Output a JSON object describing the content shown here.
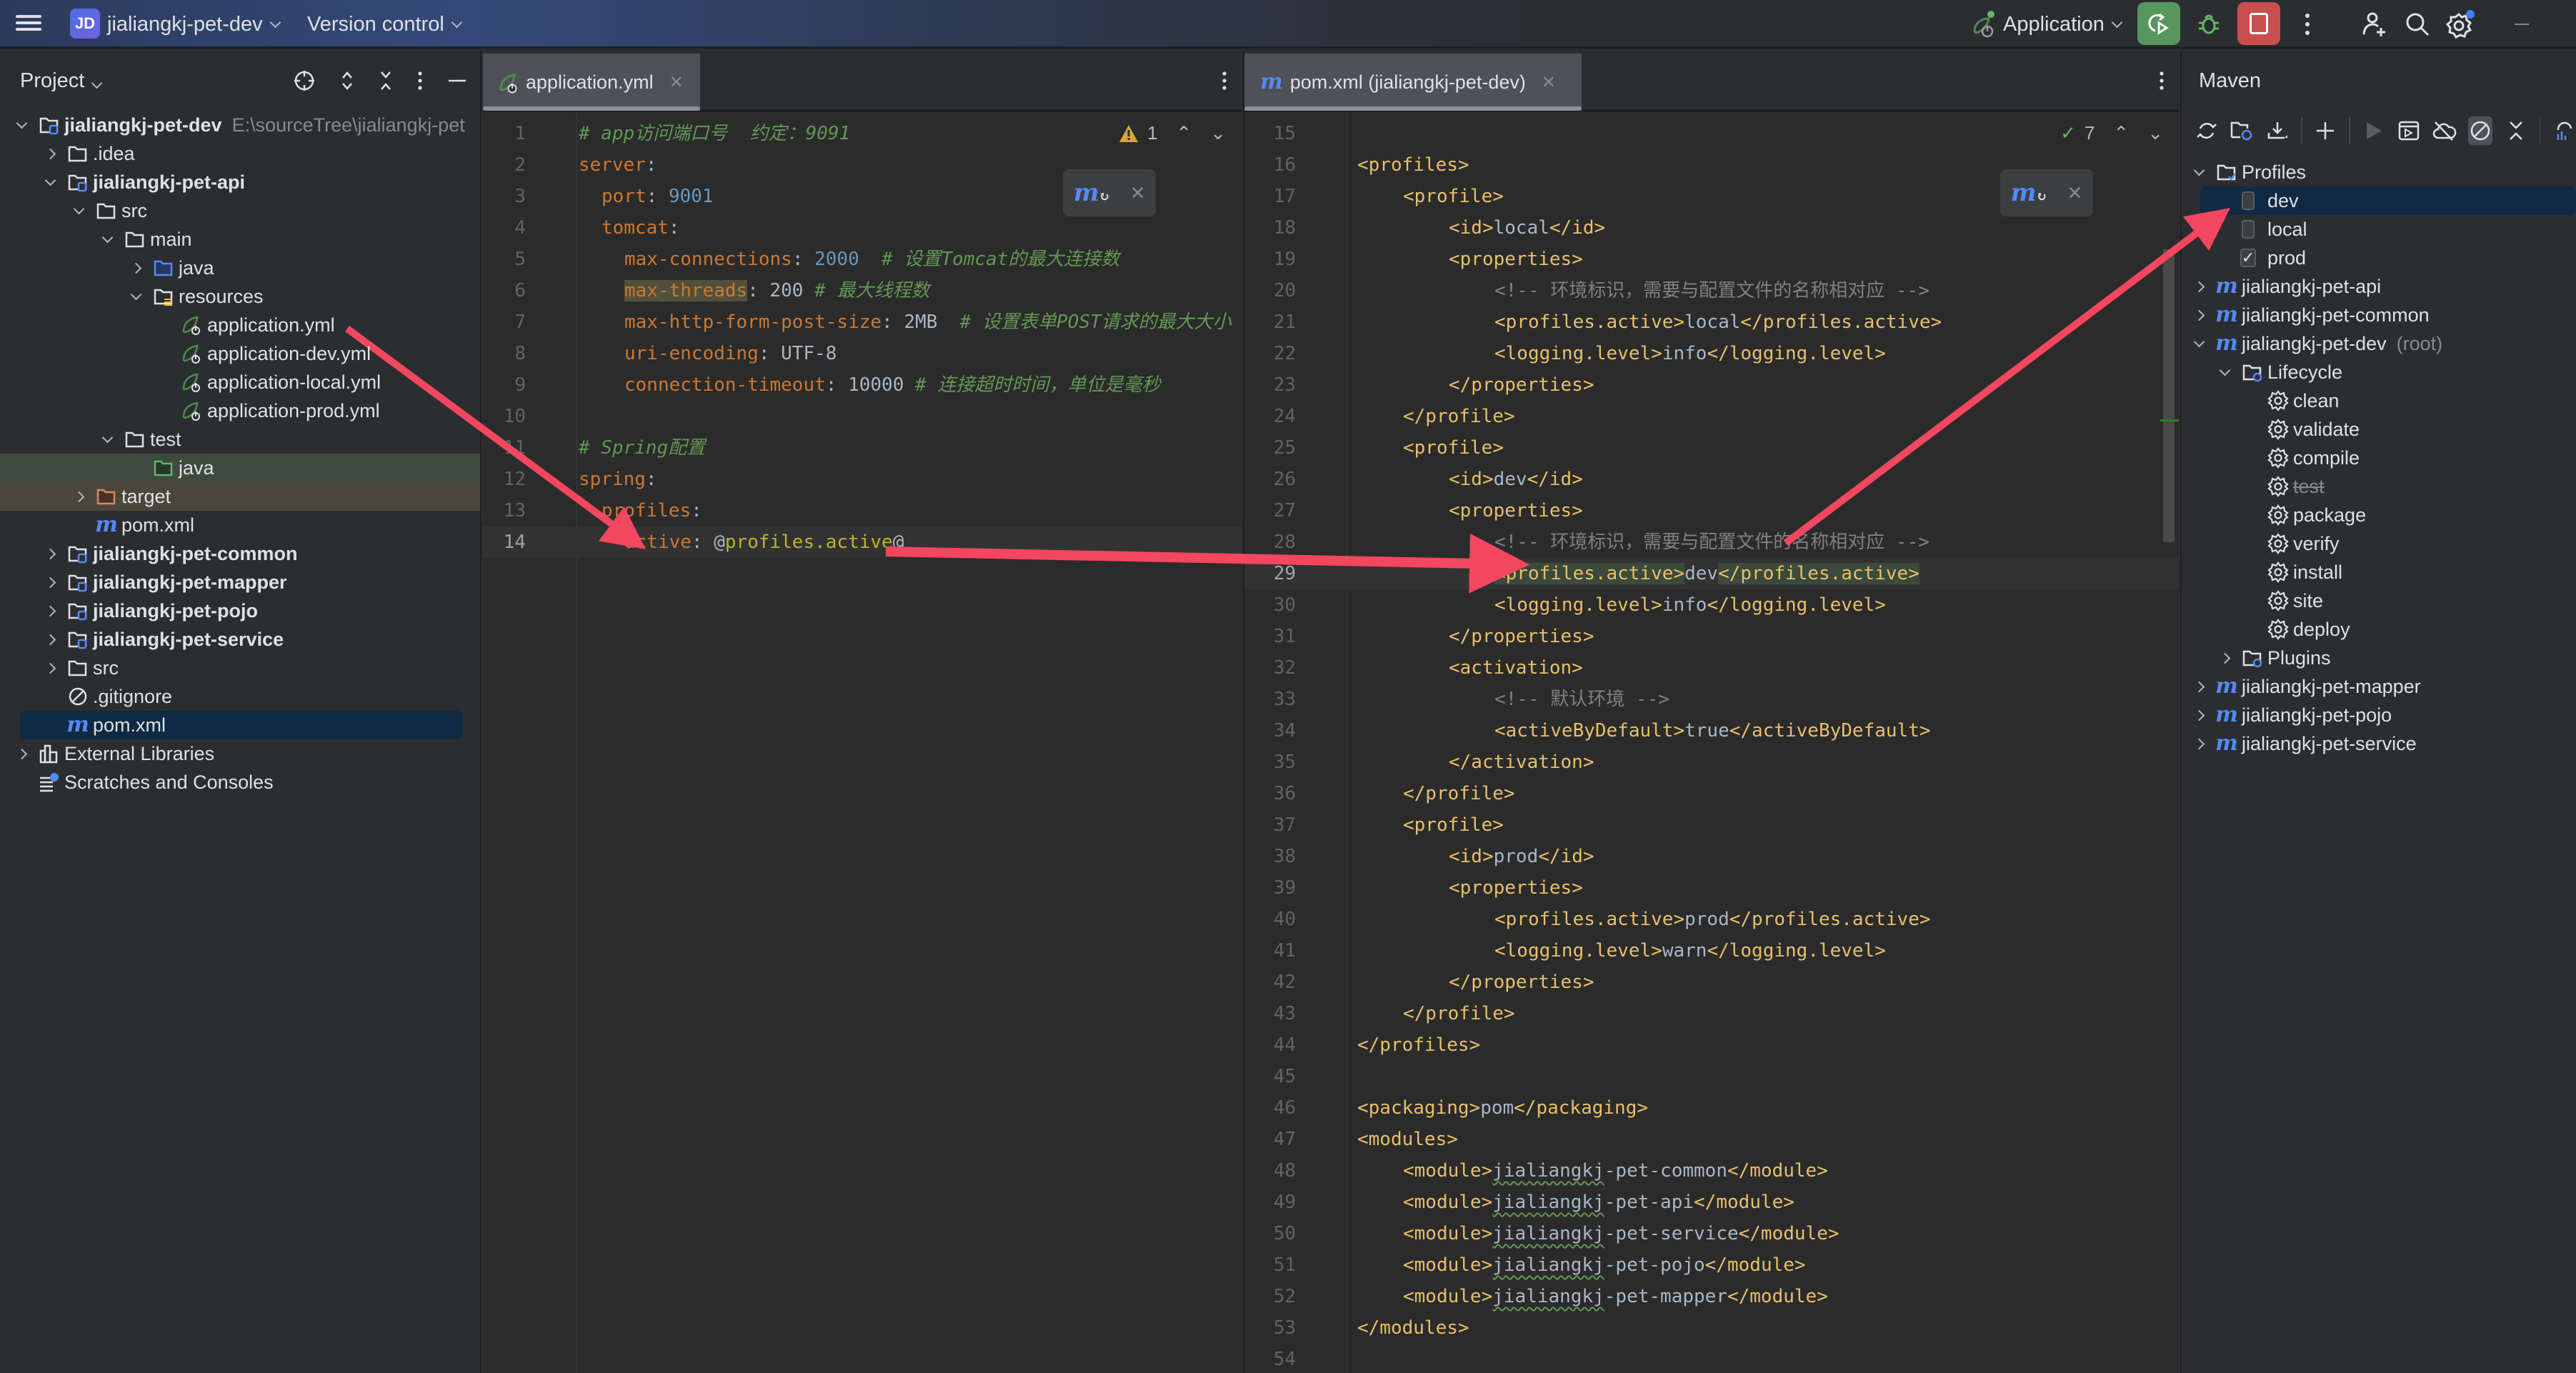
{
  "titlebar": {
    "project_badge": "JD",
    "project_name": "jialiangkj-pet-dev",
    "version_control": "Version control",
    "run_config": "Application",
    "icons": [
      "main-menu-icon",
      "rerun-icon",
      "debug-icon",
      "stop-icon",
      "more-icon",
      "add-user-icon",
      "search-icon",
      "settings-icon",
      "minimize-icon"
    ]
  },
  "project_panel": {
    "title": "Project",
    "icons": [
      "locate-icon",
      "expand-all-icon",
      "collapse-all-icon",
      "more-icon",
      "hide-icon"
    ],
    "tree": [
      {
        "depth": 0,
        "expand": "down",
        "icon": "module",
        "label": "jialiangkj-pet-dev",
        "bold": true,
        "path": "E:\\sourceTree\\jialiangkj-pet"
      },
      {
        "depth": 1,
        "expand": "right",
        "icon": "folder",
        "label": ".idea"
      },
      {
        "depth": 1,
        "expand": "down",
        "icon": "module",
        "label": "jialiangkj-pet-api",
        "bold": true
      },
      {
        "depth": 2,
        "expand": "down",
        "icon": "folder",
        "label": "src"
      },
      {
        "depth": 3,
        "expand": "down",
        "icon": "folder",
        "label": "main"
      },
      {
        "depth": 4,
        "expand": "right",
        "icon": "folder-source",
        "label": "java"
      },
      {
        "depth": 4,
        "expand": "down",
        "icon": "folder-resources",
        "label": "resources"
      },
      {
        "depth": 5,
        "expand": "none",
        "icon": "spring",
        "label": "application.yml"
      },
      {
        "depth": 5,
        "expand": "none",
        "icon": "spring",
        "label": "application-dev.yml"
      },
      {
        "depth": 5,
        "expand": "none",
        "icon": "spring",
        "label": "application-local.yml"
      },
      {
        "depth": 5,
        "expand": "none",
        "icon": "spring",
        "label": "application-prod.yml"
      },
      {
        "depth": 3,
        "expand": "down",
        "icon": "folder",
        "label": "test"
      },
      {
        "depth": 4,
        "expand": "none",
        "icon": "folder-test",
        "label": "java",
        "row": "test"
      },
      {
        "depth": 2,
        "expand": "right",
        "icon": "folder-excluded",
        "label": "target",
        "row": "target"
      },
      {
        "depth": 2,
        "expand": "none",
        "icon": "maven",
        "label": "pom.xml"
      },
      {
        "depth": 1,
        "expand": "right",
        "icon": "module",
        "label": "jialiangkj-pet-common",
        "bold": true
      },
      {
        "depth": 1,
        "expand": "right",
        "icon": "module",
        "label": "jialiangkj-pet-mapper",
        "bold": true
      },
      {
        "depth": 1,
        "expand": "right",
        "icon": "module",
        "label": "jialiangkj-pet-pojo",
        "bold": true
      },
      {
        "depth": 1,
        "expand": "right",
        "icon": "module",
        "label": "jialiangkj-pet-service",
        "bold": true
      },
      {
        "depth": 1,
        "expand": "right",
        "icon": "folder",
        "label": "src"
      },
      {
        "depth": 1,
        "expand": "none",
        "icon": "ignore",
        "label": ".gitignore"
      },
      {
        "depth": 1,
        "expand": "none",
        "icon": "maven",
        "label": "pom.xml",
        "row": "selected"
      },
      {
        "depth": 0,
        "expand": "right",
        "icon": "library",
        "label": "External Libraries"
      },
      {
        "depth": 0,
        "expand": "none",
        "icon": "scratches",
        "label": "Scratches and Consoles"
      }
    ]
  },
  "editor_left": {
    "tab_label": "application.yml",
    "inspection": {
      "warnings": "1"
    },
    "lines": [
      {
        "n": "1",
        "indent": 0,
        "parts": [
          [
            "c-cmt",
            "# app访问端口号  约定：9091"
          ]
        ]
      },
      {
        "n": "2",
        "indent": 0,
        "parts": [
          [
            "c-key",
            "server"
          ],
          [
            "c-punc",
            ":"
          ]
        ]
      },
      {
        "n": "3",
        "indent": 1,
        "parts": [
          [
            "c-key",
            "port"
          ],
          [
            "c-punc",
            ": "
          ],
          [
            "c-num",
            "9001"
          ]
        ]
      },
      {
        "n": "4",
        "indent": 1,
        "parts": [
          [
            "c-key",
            "tomcat"
          ],
          [
            "c-punc",
            ":"
          ]
        ]
      },
      {
        "n": "5",
        "indent": 2,
        "parts": [
          [
            "c-key",
            "max-connections"
          ],
          [
            "c-punc",
            ": "
          ],
          [
            "c-num",
            "2000"
          ],
          [
            "c-cmt",
            "  # 设置Tomcat的最大连接数"
          ]
        ]
      },
      {
        "n": "6",
        "indent": 2,
        "parts": [
          [
            "c-key hl-word",
            "max-threads"
          ],
          [
            "c-punc",
            ": "
          ],
          [
            "c-val",
            "200"
          ],
          [
            "c-cmt",
            " # 最大线程数"
          ]
        ]
      },
      {
        "n": "7",
        "indent": 2,
        "parts": [
          [
            "c-key",
            "max-http-form-post-size"
          ],
          [
            "c-punc",
            ": "
          ],
          [
            "c-val",
            "2MB"
          ],
          [
            "c-cmt",
            "  # 设置表单POST请求的最大大小"
          ]
        ]
      },
      {
        "n": "8",
        "indent": 2,
        "parts": [
          [
            "c-key",
            "uri-encoding"
          ],
          [
            "c-punc",
            ": "
          ],
          [
            "c-val",
            "UTF-8"
          ]
        ]
      },
      {
        "n": "9",
        "indent": 2,
        "parts": [
          [
            "c-key",
            "connection-timeout"
          ],
          [
            "c-punc",
            ": "
          ],
          [
            "c-val",
            "10000"
          ],
          [
            "c-cmt",
            " # 连接超时时间，单位是毫秒"
          ]
        ]
      },
      {
        "n": "10",
        "indent": 0,
        "parts": []
      },
      {
        "n": "11",
        "indent": 0,
        "parts": [
          [
            "c-cmt",
            "# Spring配置"
          ]
        ]
      },
      {
        "n": "12",
        "indent": 0,
        "parts": [
          [
            "c-key",
            "spring"
          ],
          [
            "c-punc",
            ":"
          ]
        ]
      },
      {
        "n": "13",
        "indent": 1,
        "parts": [
          [
            "c-key",
            "profiles"
          ],
          [
            "c-punc",
            ":"
          ]
        ]
      },
      {
        "n": "14",
        "indent": 2,
        "current": true,
        "parts": [
          [
            "c-key",
            "active"
          ],
          [
            "c-punc",
            ": "
          ],
          [
            "c-punc",
            "@"
          ],
          [
            "c-at",
            "profiles.active"
          ],
          [
            "c-punc",
            "@"
          ]
        ]
      }
    ]
  },
  "editor_right": {
    "tab_label": "pom.xml (jialiangkj-pet-dev)",
    "inspection": {
      "ok_count": "7"
    },
    "lines": [
      {
        "n": "15",
        "indent": 0,
        "parts": []
      },
      {
        "n": "16",
        "indent": 1,
        "parts": [
          [
            "c-tag",
            "<profiles>"
          ]
        ]
      },
      {
        "n": "17",
        "indent": 2,
        "parts": [
          [
            "c-tag",
            "<profile>"
          ]
        ]
      },
      {
        "n": "18",
        "indent": 3,
        "parts": [
          [
            "c-tag",
            "<id>"
          ],
          [
            "c-txt",
            "local"
          ],
          [
            "c-tag",
            "</id>"
          ]
        ]
      },
      {
        "n": "19",
        "indent": 3,
        "parts": [
          [
            "c-tag",
            "<properties>"
          ]
        ]
      },
      {
        "n": "20",
        "indent": 4,
        "parts": [
          [
            "c-xcmt",
            "<!-- 环境标识，需要与配置文件的名称相对应 -->"
          ]
        ]
      },
      {
        "n": "21",
        "indent": 4,
        "parts": [
          [
            "c-tag",
            "<profiles.active>"
          ],
          [
            "c-txt",
            "local"
          ],
          [
            "c-tag",
            "</profiles.active>"
          ]
        ]
      },
      {
        "n": "22",
        "indent": 4,
        "parts": [
          [
            "c-tag",
            "<logging.level>"
          ],
          [
            "c-txt",
            "info"
          ],
          [
            "c-tag",
            "</logging.level>"
          ]
        ]
      },
      {
        "n": "23",
        "indent": 3,
        "parts": [
          [
            "c-tag",
            "</properties>"
          ]
        ]
      },
      {
        "n": "24",
        "indent": 2,
        "parts": [
          [
            "c-tag",
            "</profile>"
          ]
        ]
      },
      {
        "n": "25",
        "indent": 2,
        "parts": [
          [
            "c-tag",
            "<profile>"
          ]
        ]
      },
      {
        "n": "26",
        "indent": 3,
        "parts": [
          [
            "c-tag",
            "<id>"
          ],
          [
            "c-txt",
            "dev"
          ],
          [
            "c-tag",
            "</id>"
          ]
        ]
      },
      {
        "n": "27",
        "indent": 3,
        "parts": [
          [
            "c-tag",
            "<properties>"
          ]
        ]
      },
      {
        "n": "28",
        "indent": 4,
        "parts": [
          [
            "c-xcmt",
            "<!-- 环境标识，需要与配置文件的名称相对应 -->"
          ]
        ]
      },
      {
        "n": "29",
        "indent": 4,
        "current": true,
        "parts": [
          [
            "c-tag hl-tag",
            "<profiles.active>"
          ],
          [
            "c-txt",
            "dev"
          ],
          [
            "c-tag hl-tag",
            "</profiles.active>"
          ]
        ]
      },
      {
        "n": "30",
        "indent": 4,
        "parts": [
          [
            "c-tag",
            "<logging.level>"
          ],
          [
            "c-txt",
            "info"
          ],
          [
            "c-tag",
            "</logging.level>"
          ]
        ]
      },
      {
        "n": "31",
        "indent": 3,
        "parts": [
          [
            "c-tag",
            "</properties>"
          ]
        ]
      },
      {
        "n": "32",
        "indent": 3,
        "parts": [
          [
            "c-tag",
            "<activation>"
          ]
        ]
      },
      {
        "n": "33",
        "indent": 4,
        "parts": [
          [
            "c-xcmt",
            "<!-- 默认环境 -->"
          ]
        ]
      },
      {
        "n": "34",
        "indent": 4,
        "parts": [
          [
            "c-tag",
            "<activeByDefault>"
          ],
          [
            "c-txt",
            "true"
          ],
          [
            "c-tag",
            "</activeByDefault>"
          ]
        ]
      },
      {
        "n": "35",
        "indent": 3,
        "parts": [
          [
            "c-tag",
            "</activation>"
          ]
        ]
      },
      {
        "n": "36",
        "indent": 2,
        "parts": [
          [
            "c-tag",
            "</profile>"
          ]
        ]
      },
      {
        "n": "37",
        "indent": 2,
        "parts": [
          [
            "c-tag",
            "<profile>"
          ]
        ]
      },
      {
        "n": "38",
        "indent": 3,
        "parts": [
          [
            "c-tag",
            "<id>"
          ],
          [
            "c-txt",
            "prod"
          ],
          [
            "c-tag",
            "</id>"
          ]
        ]
      },
      {
        "n": "39",
        "indent": 3,
        "parts": [
          [
            "c-tag",
            "<properties>"
          ]
        ]
      },
      {
        "n": "40",
        "indent": 4,
        "parts": [
          [
            "c-tag",
            "<profiles.active>"
          ],
          [
            "c-txt",
            "prod"
          ],
          [
            "c-tag",
            "</profiles.active>"
          ]
        ]
      },
      {
        "n": "41",
        "indent": 4,
        "parts": [
          [
            "c-tag",
            "<logging.level>"
          ],
          [
            "c-txt",
            "warn"
          ],
          [
            "c-tag",
            "</logging.level>"
          ]
        ]
      },
      {
        "n": "42",
        "indent": 3,
        "parts": [
          [
            "c-tag",
            "</properties>"
          ]
        ]
      },
      {
        "n": "43",
        "indent": 2,
        "parts": [
          [
            "c-tag",
            "</profile>"
          ]
        ]
      },
      {
        "n": "44",
        "indent": 1,
        "parts": [
          [
            "c-tag",
            "</profiles>"
          ]
        ]
      },
      {
        "n": "45",
        "indent": 0,
        "parts": []
      },
      {
        "n": "46",
        "indent": 1,
        "parts": [
          [
            "c-tag",
            "<packaging>"
          ],
          [
            "c-txt",
            "pom"
          ],
          [
            "c-tag",
            "</packaging>"
          ]
        ]
      },
      {
        "n": "47",
        "indent": 1,
        "parts": [
          [
            "c-tag",
            "<modules>"
          ]
        ]
      },
      {
        "n": "48",
        "indent": 2,
        "parts": [
          [
            "c-tag",
            "<module>"
          ],
          [
            "c-txt squig",
            "jialiangkj"
          ],
          [
            "c-txt",
            "-pet-common"
          ],
          [
            "c-tag",
            "</module>"
          ]
        ]
      },
      {
        "n": "49",
        "indent": 2,
        "parts": [
          [
            "c-tag",
            "<module>"
          ],
          [
            "c-txt squig",
            "jialiangkj"
          ],
          [
            "c-txt",
            "-pet-api"
          ],
          [
            "c-tag",
            "</module>"
          ]
        ]
      },
      {
        "n": "50",
        "indent": 2,
        "parts": [
          [
            "c-tag",
            "<module>"
          ],
          [
            "c-txt squig",
            "jialiangkj"
          ],
          [
            "c-txt",
            "-pet-service"
          ],
          [
            "c-tag",
            "</module>"
          ]
        ]
      },
      {
        "n": "51",
        "indent": 2,
        "parts": [
          [
            "c-tag",
            "<module>"
          ],
          [
            "c-txt squig",
            "jialiangkj"
          ],
          [
            "c-txt",
            "-pet-pojo"
          ],
          [
            "c-tag",
            "</module>"
          ]
        ]
      },
      {
        "n": "52",
        "indent": 2,
        "parts": [
          [
            "c-tag",
            "<module>"
          ],
          [
            "c-txt squig",
            "jialiangkj"
          ],
          [
            "c-txt",
            "-pet-mapper"
          ],
          [
            "c-tag",
            "</module>"
          ]
        ]
      },
      {
        "n": "53",
        "indent": 1,
        "parts": [
          [
            "c-tag",
            "</modules>"
          ]
        ]
      },
      {
        "n": "54",
        "indent": 0,
        "parts": []
      }
    ]
  },
  "maven_panel": {
    "title": "Maven",
    "toolbar_icons": [
      "reload-icon",
      "reimport-folder-icon",
      "download-icon",
      "add-icon",
      "run-icon",
      "execute-goal-icon",
      "offline-icon",
      "skip-tests-icon",
      "collapse-icon",
      "analyze-icon"
    ],
    "tree": [
      {
        "depth": 0,
        "expand": "down",
        "icon": "profiles-folder",
        "label": "Profiles"
      },
      {
        "depth": 1,
        "expand": "none",
        "icon": "checkbox",
        "checked": false,
        "label": "dev",
        "row": "selected"
      },
      {
        "depth": 1,
        "expand": "none",
        "icon": "checkbox",
        "checked": false,
        "label": "local"
      },
      {
        "depth": 1,
        "expand": "none",
        "icon": "checkbox",
        "checked": true,
        "label": "prod"
      },
      {
        "depth": 0,
        "expand": "right",
        "icon": "maven",
        "label": "jialiangkj-pet-api"
      },
      {
        "depth": 0,
        "expand": "right",
        "icon": "maven",
        "label": "jialiangkj-pet-common"
      },
      {
        "depth": 0,
        "expand": "down",
        "icon": "maven",
        "label": "jialiangkj-pet-dev",
        "suffix": "(root)"
      },
      {
        "depth": 1,
        "expand": "down",
        "icon": "lifecycle-folder",
        "label": "Lifecycle"
      },
      {
        "depth": 2,
        "expand": "none",
        "icon": "gear",
        "label": "clean"
      },
      {
        "depth": 2,
        "expand": "none",
        "icon": "gear",
        "label": "validate"
      },
      {
        "depth": 2,
        "expand": "none",
        "icon": "gear",
        "label": "compile"
      },
      {
        "depth": 2,
        "expand": "none",
        "icon": "gear",
        "label": "test",
        "skipped": true
      },
      {
        "depth": 2,
        "expand": "none",
        "icon": "gear",
        "label": "package"
      },
      {
        "depth": 2,
        "expand": "none",
        "icon": "gear",
        "label": "verify"
      },
      {
        "depth": 2,
        "expand": "none",
        "icon": "gear",
        "label": "install"
      },
      {
        "depth": 2,
        "expand": "none",
        "icon": "gear",
        "label": "site"
      },
      {
        "depth": 2,
        "expand": "none",
        "icon": "gear",
        "label": "deploy"
      },
      {
        "depth": 1,
        "expand": "right",
        "icon": "lifecycle-folder",
        "label": "Plugins"
      },
      {
        "depth": 0,
        "expand": "right",
        "icon": "maven",
        "label": "jialiangkj-pet-mapper"
      },
      {
        "depth": 0,
        "expand": "right",
        "icon": "maven",
        "label": "jialiangkj-pet-pojo"
      },
      {
        "depth": 0,
        "expand": "right",
        "icon": "maven",
        "label": "jialiangkj-pet-service"
      }
    ]
  },
  "colors": {
    "annotation_arrow": "#f2475f",
    "accent_blue": "#548af7",
    "run_green": "#57965c",
    "stop_red": "#c94f4f"
  }
}
